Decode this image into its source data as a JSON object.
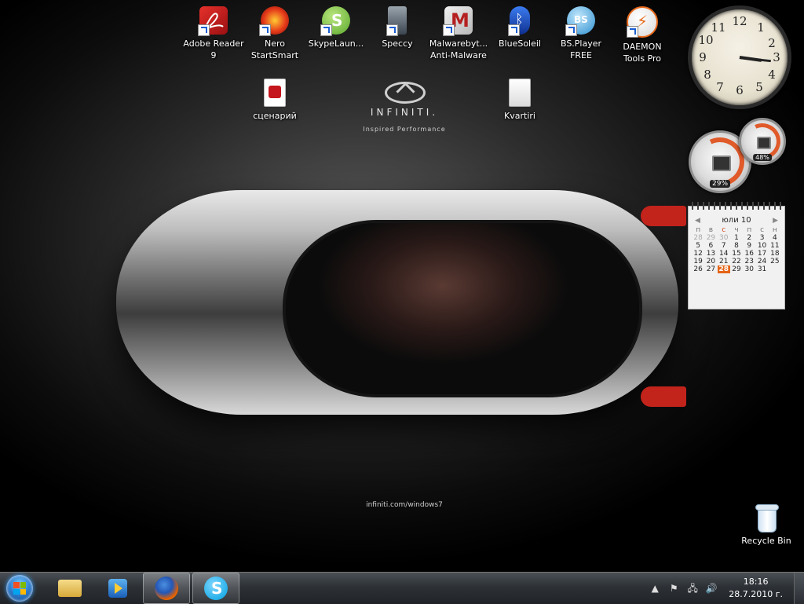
{
  "desktop_icons": [
    {
      "label": "Adobe Reader\n9",
      "icon": "adobe-reader-icon",
      "color": "#c4161c"
    },
    {
      "label": "Nero\nStartSmart",
      "icon": "nero-icon",
      "color": "#d9241f"
    },
    {
      "label": "SkypeLaun...",
      "icon": "skype-launcher-icon",
      "color": "#7cc242"
    },
    {
      "label": "Speccy",
      "icon": "speccy-icon",
      "color": "#4b5a6a"
    },
    {
      "label": "Malwarebyt...\nAnti-Malware",
      "icon": "malwarebytes-icon",
      "color": "#b51f1f"
    },
    {
      "label": "BlueSoleil",
      "icon": "bluetooth-icon",
      "color": "#1a4fc2"
    },
    {
      "label": "BS.Player\nFREE",
      "icon": "bsplayer-icon",
      "color": "#2e9bd6"
    },
    {
      "label": "DAEMON\nTools Pro",
      "icon": "daemon-tools-icon",
      "color": "#e86a1c"
    },
    {
      "label": "сценарий",
      "icon": "pdf-file-icon",
      "color": "#c4161c"
    },
    {
      "label": "Kvartiri",
      "icon": "text-file-icon",
      "color": "#e8e8e8"
    }
  ],
  "brand": {
    "name": "INFINITI.",
    "tagline": "Inspired Performance",
    "url": "infiniti.com/windows7"
  },
  "gadgets": {
    "clock": {
      "numbers": [
        "12",
        "1",
        "2",
        "3",
        "4",
        "5",
        "6",
        "7",
        "8",
        "9",
        "10",
        "11"
      ],
      "hour": 3,
      "minute": 16
    },
    "cpu_meter": {
      "cpu_percent": "29%",
      "ram_percent": "48%"
    },
    "calendar": {
      "month_label": "юли 10",
      "days_of_week": [
        "п",
        "в",
        "с",
        "ч",
        "п",
        "с",
        "н"
      ],
      "weeks": [
        [
          "28",
          "29",
          "30",
          "1",
          "2",
          "3",
          "4"
        ],
        [
          "5",
          "6",
          "7",
          "8",
          "9",
          "10",
          "11"
        ],
        [
          "12",
          "13",
          "14",
          "15",
          "16",
          "17",
          "18"
        ],
        [
          "19",
          "20",
          "21",
          "22",
          "23",
          "24",
          "25"
        ],
        [
          "26",
          "27",
          "28",
          "29",
          "30",
          "31",
          ""
        ]
      ],
      "today": "28"
    }
  },
  "recycle_bin": {
    "label": "Recycle Bin"
  },
  "taskbar": {
    "pinned": [
      {
        "name": "windows-explorer-icon",
        "color": "#e8c35a"
      },
      {
        "name": "media-player-icon",
        "color": "#2a79c9"
      },
      {
        "name": "firefox-icon",
        "color": "#e66000"
      },
      {
        "name": "skype-icon",
        "color": "#00aff0"
      }
    ],
    "tray": {
      "time": "18:16",
      "date": "28.7.2010 г."
    }
  }
}
